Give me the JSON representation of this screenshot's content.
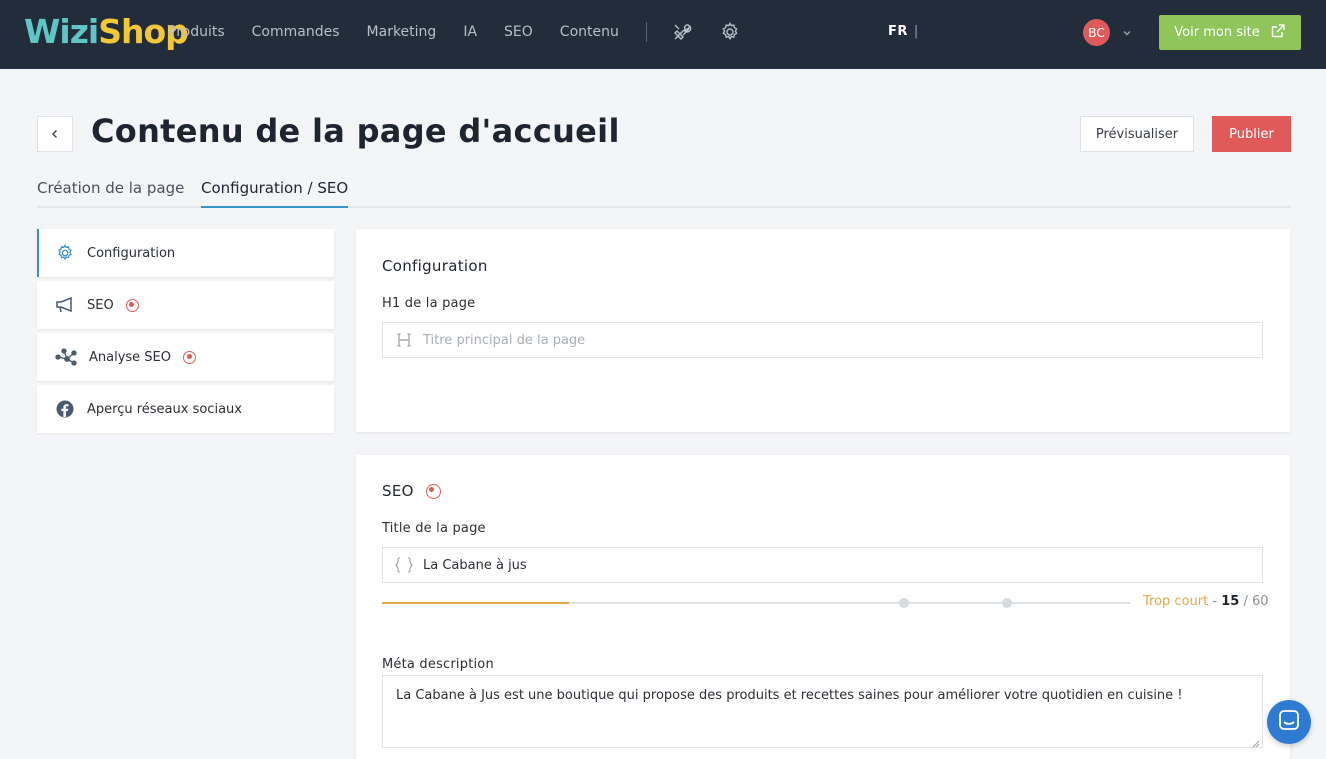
{
  "brand": {
    "logo_part1": "Wizi",
    "logo_part2": "Shop"
  },
  "nav": {
    "items": [
      "Produits",
      "Commandes",
      "Marketing",
      "IA",
      "SEO",
      "Contenu"
    ],
    "icons": [
      "tools-icon",
      "gear-icon"
    ]
  },
  "lang": {
    "code": "FR",
    "separator": "|"
  },
  "user": {
    "initials": "BC"
  },
  "site_button": {
    "label": "Voir mon site"
  },
  "header": {
    "title": "Contenu de la page d'accueil",
    "preview_label": "Prévisualiser",
    "publish_label": "Publier"
  },
  "tabs": [
    {
      "label": "Création de la page"
    },
    {
      "label": "Configuration / SEO"
    }
  ],
  "sidebar": {
    "items": [
      {
        "label": "Configuration",
        "icon": "gear-icon"
      },
      {
        "label": "SEO",
        "icon": "megaphone-icon"
      },
      {
        "label": "Analyse SEO",
        "icon": "network-icon"
      },
      {
        "label": "Aperçu réseaux sociaux",
        "icon": "facebook-icon"
      }
    ]
  },
  "config_card": {
    "title": "Configuration",
    "h1_label": "H1 de la page",
    "h1_placeholder": "Titre principal de la page"
  },
  "seo_card": {
    "title": "SEO",
    "title_label": "Title de la page",
    "title_value": "La Cabane à jus",
    "length_status": "Trop court",
    "length_dash": "-",
    "length_current": "15",
    "length_slash": "/",
    "length_max": "60",
    "length_fraction": 0.25,
    "meta_label": "Méta description",
    "meta_value": "La Cabane à Jus est une boutique qui propose des produits et recettes saines pour améliorer votre quotidien en cuisine !"
  },
  "colors": {
    "nav_bg": "#222c3a",
    "accent_green": "#8fc55b",
    "accent_red": "#e05a5a",
    "accent_blue": "#3a92c9",
    "warning": "#e6a64a"
  }
}
